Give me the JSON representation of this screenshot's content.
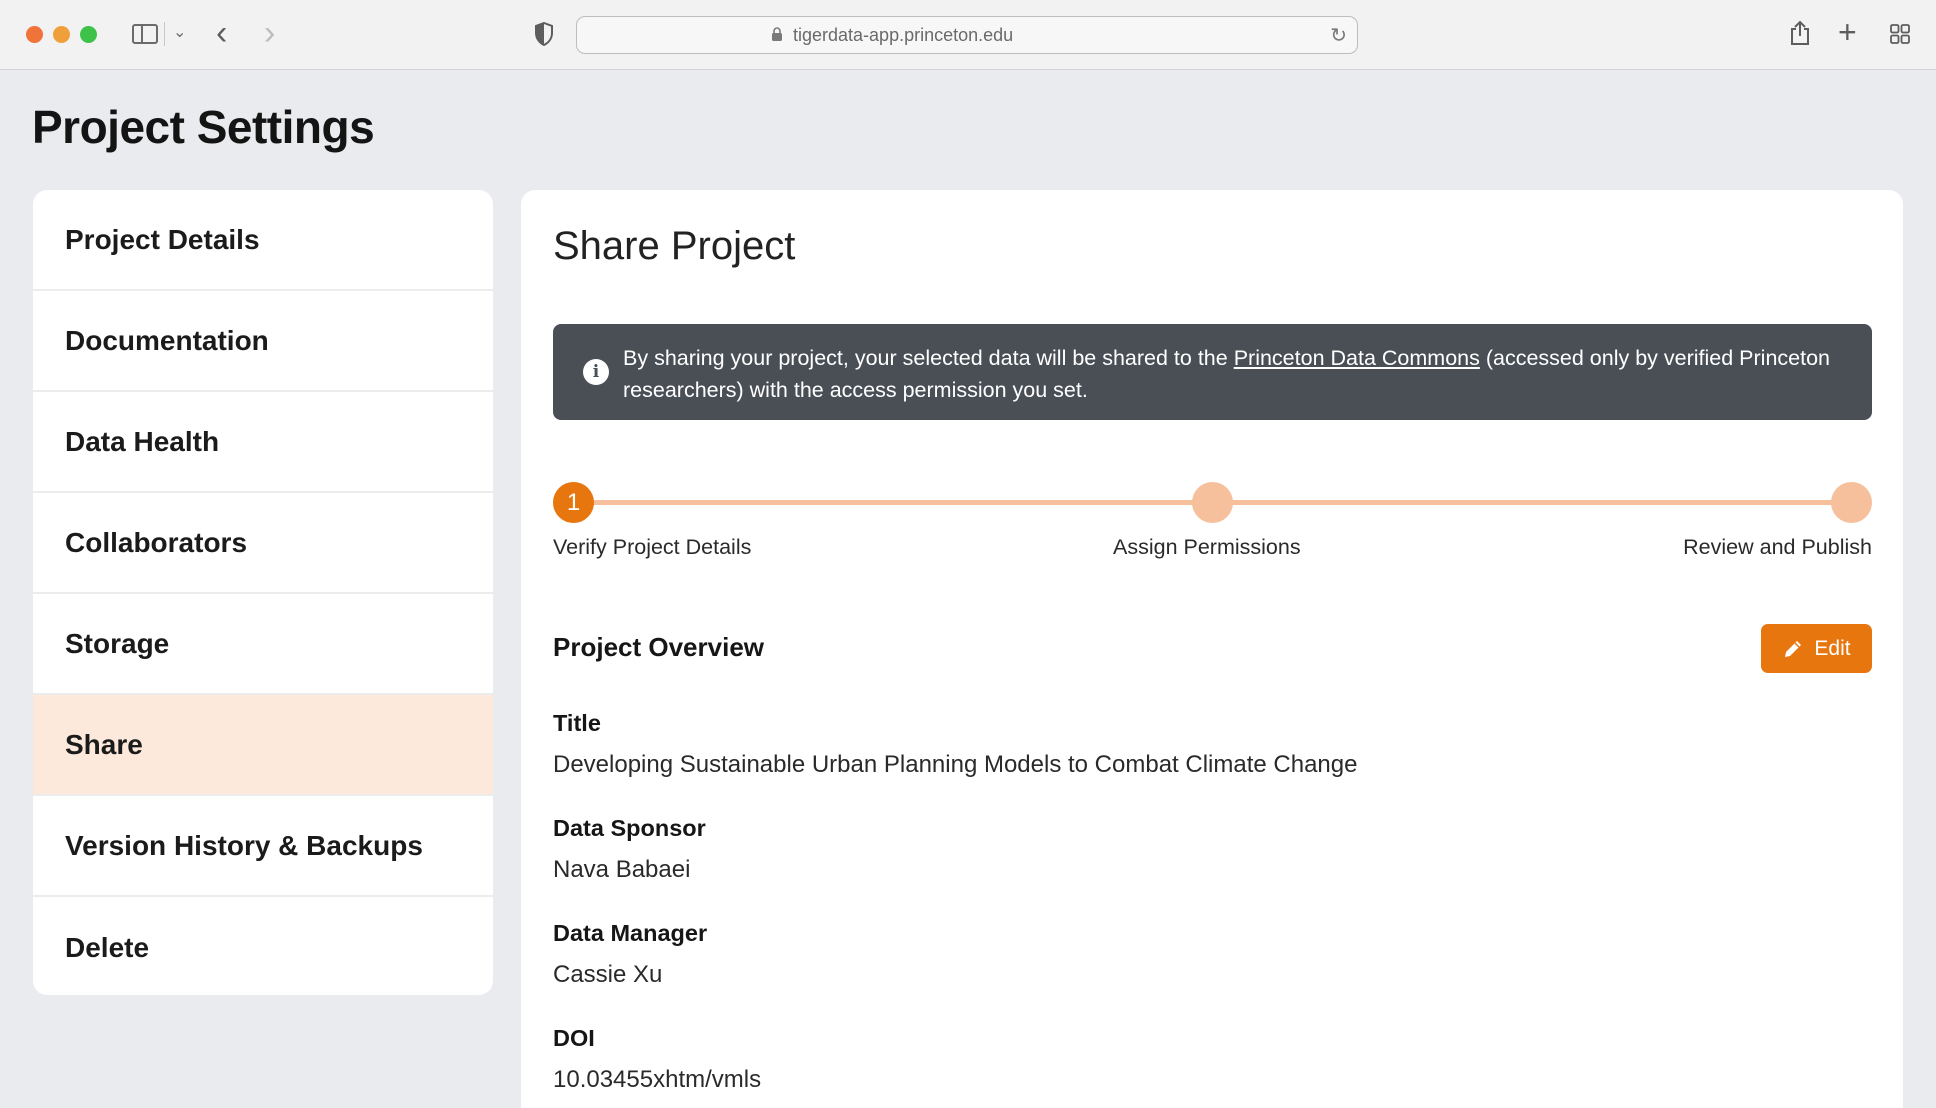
{
  "browser": {
    "url": "tigerdata-app.princeton.edu"
  },
  "page": {
    "title": "Project Settings"
  },
  "sidebar": {
    "items": [
      {
        "label": "Project Details"
      },
      {
        "label": "Documentation"
      },
      {
        "label": "Data Health"
      },
      {
        "label": "Collaborators"
      },
      {
        "label": "Storage"
      },
      {
        "label": "Share",
        "active": true
      },
      {
        "label": "Version History & Backups"
      },
      {
        "label": "Delete"
      }
    ]
  },
  "main": {
    "heading": "Share Project",
    "banner": {
      "text_before": "By sharing your project, your selected data will be shared to the ",
      "link": "Princeton Data Commons",
      "text_after": " (accessed only by verified Princeton researchers) with the access permission you set."
    },
    "stepper": {
      "current_step": 1,
      "steps": [
        {
          "number": "1",
          "label": "Verify Project Details"
        },
        {
          "number": "",
          "label": "Assign Permissions"
        },
        {
          "number": "",
          "label": "Review and Publish"
        }
      ]
    },
    "overview": {
      "title": "Project Overview",
      "edit_label": "Edit",
      "fields": [
        {
          "label": "Title",
          "value": "Developing Sustainable Urban Planning Models to Combat Climate Change"
        },
        {
          "label": "Data Sponsor",
          "value": "Nava Babaei"
        },
        {
          "label": "Data Manager",
          "value": "Cassie Xu"
        },
        {
          "label": "DOI",
          "value": "10.03455xhtm/vmls"
        }
      ]
    }
  },
  "colors": {
    "accent": "#e8760f",
    "accent_light": "#f6c09d",
    "active_item_bg": "#fde9dc",
    "banner_bg": "#4a4f56",
    "page_bg": "#e9ebee"
  }
}
